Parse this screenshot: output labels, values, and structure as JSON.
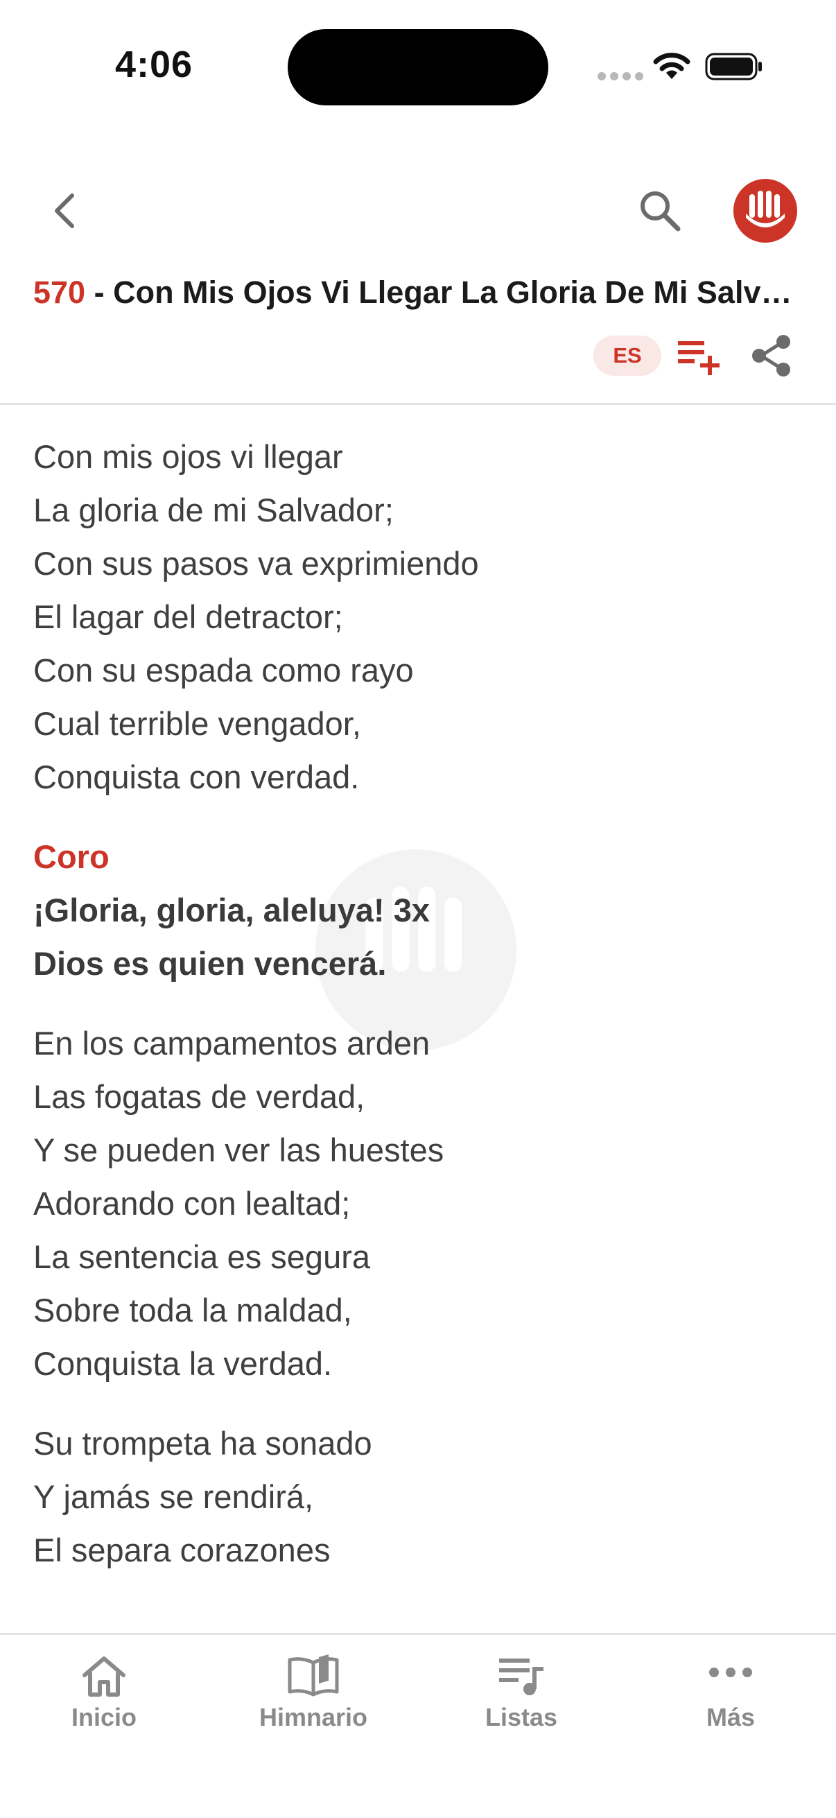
{
  "status_bar": {
    "time": "4:06"
  },
  "header": {
    "song_number": "570",
    "song_title": " - Con Mis Ojos Vi Llegar La Gloria De Mi Salvador",
    "language_badge": "ES"
  },
  "lyrics": {
    "stanza1": [
      "Con mis ojos vi llegar",
      "La gloria de mi Salvador;",
      "Con sus pasos va exprimiendo",
      "El lagar del detractor;",
      "Con su espada como rayo",
      "Cual terrible vengador,",
      "Conquista con verdad."
    ],
    "chorus": {
      "label": "Coro",
      "lines": [
        "¡Gloria, gloria, aleluya! 3x",
        "Dios es quien vencerá."
      ]
    },
    "stanza2": [
      "En los campamentos arden",
      "Las fogatas de verdad,",
      "Y se pueden ver las huestes",
      "Adorando con lealtad;",
      "La sentencia es segura",
      "Sobre toda la maldad,",
      "Conquista la verdad."
    ],
    "stanza3": [
      "Su trompeta ha sonado",
      "Y jamás se rendirá,",
      "El separa corazones"
    ]
  },
  "tabs": [
    {
      "label": "Inicio",
      "icon": "home-icon"
    },
    {
      "label": "Himnario",
      "icon": "book-icon"
    },
    {
      "label": "Listas",
      "icon": "playlist-icon"
    },
    {
      "label": "Más",
      "icon": "more-icon"
    }
  ],
  "colors": {
    "accent": "#cc3427",
    "badge_bg": "#fae8e6",
    "tab_inactive": "#8a8a8a"
  }
}
